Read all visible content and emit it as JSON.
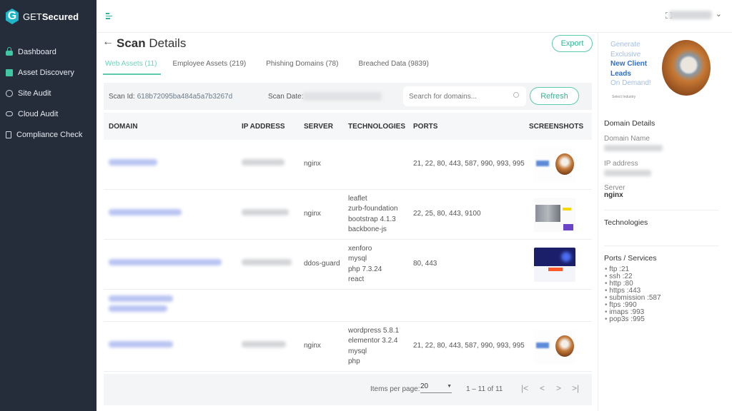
{
  "app": {
    "brand_prefix": "GET",
    "brand_suffix": "Secured",
    "logo_letter": "G"
  },
  "sidebar": {
    "items": [
      {
        "label": "Dashboard",
        "icon": "lock-icon"
      },
      {
        "label": "Asset Discovery",
        "icon": "database-icon"
      },
      {
        "label": "Site Audit",
        "icon": "globe-icon"
      },
      {
        "label": "Cloud Audit",
        "icon": "cloud-icon"
      },
      {
        "label": "Compliance Check",
        "icon": "document-icon"
      }
    ]
  },
  "topbar": {
    "user_chevron": "⌄"
  },
  "header": {
    "back": "←",
    "title_bold": "Scan",
    "title_rest": " Details",
    "export_label": "Export"
  },
  "tabs": [
    {
      "label": "Web Assets (11)",
      "active": true
    },
    {
      "label": "Employee Assets (219)",
      "active": false
    },
    {
      "label": "Phishing Domains (78)",
      "active": false
    },
    {
      "label": "Breached Data (9839)",
      "active": false
    }
  ],
  "scan": {
    "id_label": "Scan Id:",
    "id_value": "618b72095ba484a5a7b3267d",
    "date_label": "Scan Date:",
    "search_placeholder": "Search for domains...",
    "refresh_label": "Refresh"
  },
  "table": {
    "columns": [
      "DOMAIN",
      "IP ADDRESS",
      "SERVER",
      "TECHNOLOGIES",
      "PORTS",
      "SCREENSHOTS"
    ],
    "rows": [
      {
        "server": "nginx",
        "technologies": [],
        "ports": "21, 22, 80, 443, 587, 990, 993, 995",
        "screenshot": "lead-gen-site"
      },
      {
        "server": "nginx",
        "technologies": [
          "leaflet",
          "zurb-foundation",
          "bootstrap 4.1.3",
          "backbone-js"
        ],
        "ports": "22, 25, 80, 443, 9100",
        "screenshot": "news-site"
      },
      {
        "server": "ddos-guard",
        "technologies": [
          "xenforo",
          "mysql",
          "php 7.3.24",
          "react"
        ],
        "ports": "80, 443",
        "screenshot": "forum-site"
      },
      {
        "server": "",
        "technologies": [],
        "ports": "",
        "screenshot": ""
      },
      {
        "server": "nginx",
        "technologies": [
          "wordpress 5.8.1",
          "elementor 3.2.4",
          "mysql",
          "php"
        ],
        "ports": "21, 22, 80, 443, 587, 990, 993, 995",
        "screenshot": "lead-gen-site"
      }
    ]
  },
  "pagination": {
    "items_per_page_label": "Items per page:",
    "items_per_page": "20",
    "range": "1 – 11 of 11",
    "first": "|<",
    "prev": "<",
    "next": ">",
    "last": ">|"
  },
  "details": {
    "promo": {
      "line1": "Generate",
      "line2": "Exclusive",
      "line3": "New Client",
      "line4": "Leads",
      "line5": "On Demand!",
      "sub": "Select Industry"
    },
    "title": "Domain Details",
    "domain_name_label": "Domain Name",
    "ip_label": "IP address",
    "server_label": "Server",
    "server_value": "nginx",
    "technologies_label": "Technologies",
    "ports_label": "Ports / Services",
    "ports": [
      "ftp :21",
      "ssh :22",
      "http :80",
      "https :443",
      "submission :587",
      "ftps :990",
      "imaps :993",
      "pop3s :995"
    ]
  },
  "colors": {
    "sidebar_bg": "#252c3a",
    "accent": "#5ccab0",
    "link_blue": "#2f6fc4"
  }
}
